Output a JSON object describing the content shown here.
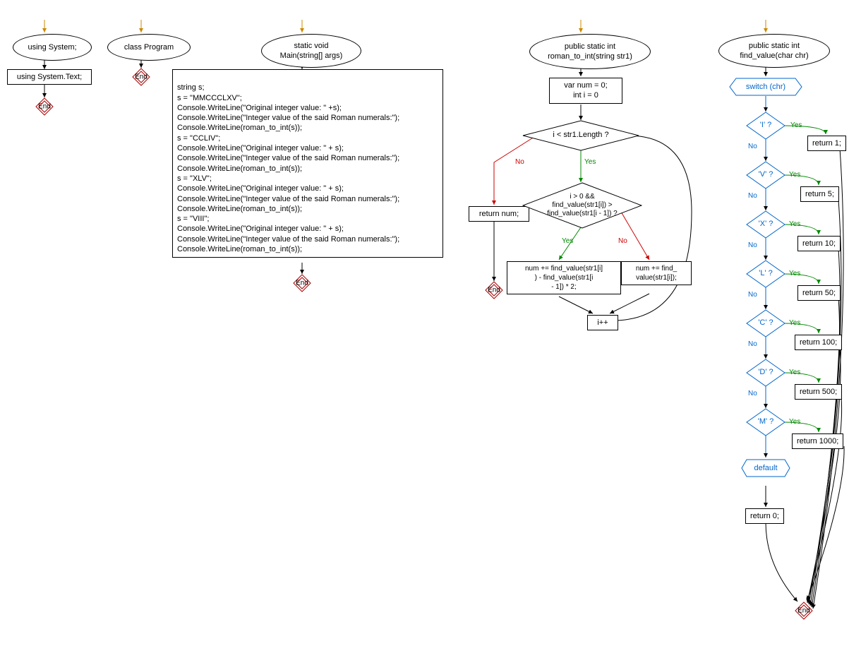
{
  "col1": {
    "ellipse": "using System;",
    "rect": "using System.Text;",
    "end": "End"
  },
  "col2": {
    "ellipse": "class Program",
    "end": "End"
  },
  "col3": {
    "ellipse": "static void\nMain(string[] args)",
    "rect": "string s;\ns = \"MMCCCLXV\";\nConsole.WriteLine(\"Original integer value: \" +s);\nConsole.WriteLine(\"Integer value of the said Roman numerals:\");\nConsole.WriteLine(roman_to_int(s));\ns = \"CCLIV\";\nConsole.WriteLine(\"Original integer value: \" + s);\nConsole.WriteLine(\"Integer value of the said Roman numerals:\");\nConsole.WriteLine(roman_to_int(s));\ns = \"XLV\";\nConsole.WriteLine(\"Original integer value: \" + s);\nConsole.WriteLine(\"Integer value of the said Roman numerals:\");\nConsole.WriteLine(roman_to_int(s));\ns = \"VIII\";\nConsole.WriteLine(\"Original integer value: \" + s);\nConsole.WriteLine(\"Integer value of the said Roman numerals:\");\nConsole.WriteLine(roman_to_int(s));",
    "end": "End"
  },
  "col4": {
    "ellipse": "public static int\nroman_to_int(string str1)",
    "init": "var num = 0;\nint i = 0",
    "cond1": "i < str1.Length ?",
    "ret": "return num;",
    "cond2": "i > 0 &&\nfind_value(str1[i]) >\nfind_value(str1[i - 1]) ?",
    "yes2": "num += find_value(str1[i]\n) - find_value(str1[i\n- 1]) * 2;",
    "no2": "num += find_\nvalue(str1[i]);",
    "inc": "i++",
    "end": "End"
  },
  "col5": {
    "ellipse": "public static int\nfind_value(char chr)",
    "switch": "switch (chr)",
    "cases": [
      "'I' ?",
      "'V' ?",
      "'X' ?",
      "'L' ?",
      "'C' ?",
      "'D' ?",
      "'M' ?"
    ],
    "default": "default",
    "returns": [
      "return 1;",
      "return 5;",
      "return 10;",
      "return 50;",
      "return 100;",
      "return 500;",
      "return 1000;"
    ],
    "ret0": "return 0;",
    "end": "End"
  },
  "labels": {
    "yes": "Yes",
    "no": "No"
  }
}
